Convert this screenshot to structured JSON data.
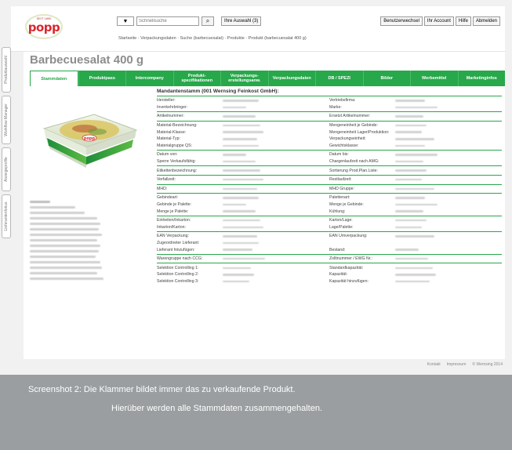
{
  "header": {
    "logo_sub": "SEIT 1890",
    "logo_word": "popp",
    "search_type": "▼",
    "search_placeholder": "Schnellsuche",
    "selection_button": "Ihre Auswahl (3)",
    "account_buttons": [
      "Benutzerwechsel",
      "Ihr Account",
      "Hilfe",
      "Abmelden"
    ],
    "breadcrumb": "Startseite · Verpackungsdaten · Suche (barbecuesalat) · Produkte · Produkt (barbecuesalat 400 g)"
  },
  "vertical_tabs": [
    "Produktauswahl",
    "Workflow Manager",
    "Anzeigeprofile",
    "Lieferantenfokus"
  ],
  "page": {
    "title": "Barbecuesalat 400 g",
    "tabs": [
      "Stammdaten",
      "Produktpass",
      "Intercompany",
      "Produkt-\nspezifikationen",
      "Verpackungs-\nerstellungsanw.",
      "Verpackungsdaten",
      "DB / SPEZI",
      "Bilder",
      "Werbemittel",
      "Marketinginfos"
    ],
    "active_tab": 0,
    "section_title": "Mandantenstamm (001 Wernsing Feinkost GmbH):",
    "groups": [
      [
        [
          "Hersteller:",
          "Vertriebsfirma:"
        ],
        [
          "Inverkehrbringer:",
          "Marke:"
        ]
      ],
      [
        [
          "Artikelnummer:",
          "Ersetzt Artikelnummer:"
        ]
      ],
      [
        [
          "Material-Bezeichnung:",
          "Mengeneinheit je Gebinde:"
        ],
        [
          "Material-Klasse:",
          "Mengeneinheit Lager/Produktion:"
        ],
        [
          "Material-Typ:",
          "Verpackungseinheit:"
        ],
        [
          "Materialgruppe QS:",
          "Gewichtsklasse:"
        ]
      ],
      [
        [
          "Datum von:",
          "Datum bis:"
        ],
        [
          "Sperre Verkaufsfähig:",
          "Chargenlaufzeit nach AMG:"
        ]
      ],
      [
        [
          "Etikettenbezeichnung:",
          "Sortierung Prod.Plan.Liste:"
        ]
      ],
      [
        [
          "Verfallzeit:",
          "Restlaufzeit:"
        ]
      ],
      [
        [
          "MHD:",
          "MHD Gruppe:"
        ]
      ],
      [
        [
          "Gebindeart:",
          "Palettenart:"
        ],
        [
          "Gebinde je Palette:",
          "Menge je Gebinde:"
        ],
        [
          "Menge je Palette:",
          "Kühlung:"
        ]
      ],
      [
        [
          "Einheiten/Inkarton:",
          "Karton/Lage:"
        ],
        [
          "Inkarton/Karton:",
          "Lage/Palette:"
        ]
      ],
      [
        [
          "EAN Verpackung:",
          "EAN Umverpackung:"
        ],
        [
          "Zugeordneter Lieferant:",
          ""
        ],
        [
          "Lieferant hinzufügen:",
          "Bestand:"
        ]
      ],
      [
        [
          "Warengruppe nach CCG:",
          "Zolltnummer / EWG Nr.:"
        ]
      ],
      [
        [
          "Selektion Controlling 1:",
          "Standardkapazität:"
        ],
        [
          "Selektion Controlling 2:",
          "Kapazität:"
        ],
        [
          "Selektion Controlling 3:",
          "Kapazität hinzufügen:"
        ]
      ]
    ]
  },
  "footer": [
    "Kontakt",
    "Impressum",
    "© Wernsing 2014"
  ],
  "caption": {
    "line1": "Screenshot 2:  Die Klammer bildet immer das zu verkaufende Produkt.",
    "line2": "Hierüber werden alle Stammdaten zusammengehalten."
  },
  "colors": {
    "accent": "#27a84a",
    "caption_bg": "#9a9ea0",
    "brand_red": "#d7282f"
  }
}
